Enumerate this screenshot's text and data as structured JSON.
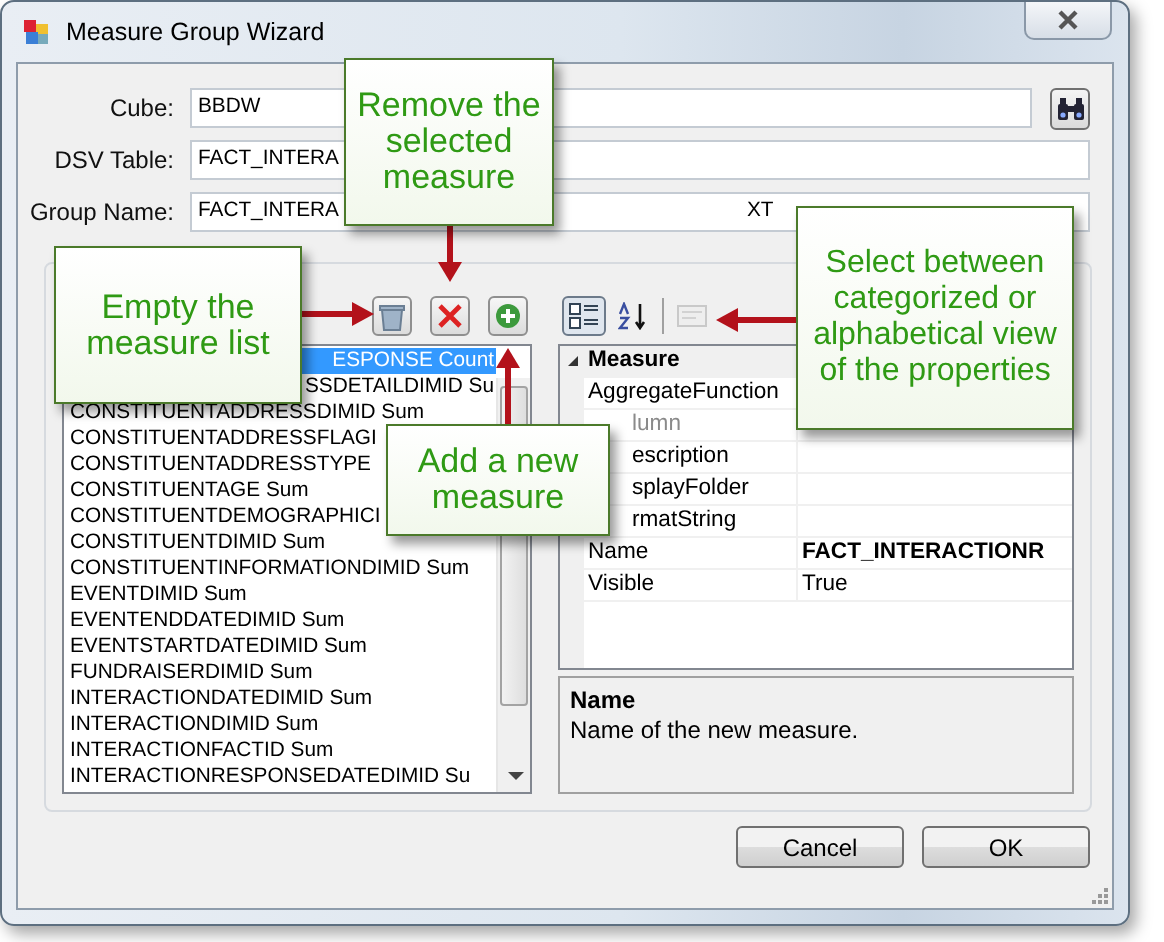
{
  "window": {
    "title": "Measure Group Wizard"
  },
  "fields": [
    {
      "label": "Cube:",
      "value": "BBDW",
      "kind": "browse"
    },
    {
      "label": "DSV Table:",
      "value": "FACT_INTERA",
      "kind": "text"
    },
    {
      "label": "Group Name:",
      "value": "FACT_INTERA",
      "value_tail": "XT",
      "kind": "text"
    }
  ],
  "measure_list": {
    "items": [
      {
        "text": "ESPONSE Count",
        "selected": true
      },
      {
        "text": "SSDETAILDIMID Su",
        "selected": false
      },
      {
        "text": "CONSTITUENTADDRESSDIMID Sum",
        "selected": false
      },
      {
        "text": "CONSTITUENTADDRESSFLAGI",
        "selected": false
      },
      {
        "text": "CONSTITUENTADDRESSTYPE",
        "selected": false
      },
      {
        "text": "CONSTITUENTAGE Sum",
        "selected": false
      },
      {
        "text": "CONSTITUENTDEMOGRAPHICI",
        "selected": false
      },
      {
        "text": "CONSTITUENTDIMID Sum",
        "selected": false
      },
      {
        "text": "CONSTITUENTINFORMATIONDIMID Sum",
        "selected": false
      },
      {
        "text": "EVENTDIMID Sum",
        "selected": false
      },
      {
        "text": "EVENTENDDATEDIMID Sum",
        "selected": false
      },
      {
        "text": "EVENTSTARTDATEDIMID Sum",
        "selected": false
      },
      {
        "text": "FUNDRAISERDIMID Sum",
        "selected": false
      },
      {
        "text": "INTERACTIONDATEDIMID Sum",
        "selected": false
      },
      {
        "text": "INTERACTIONDIMID Sum",
        "selected": false
      },
      {
        "text": "INTERACTIONFACTID Sum",
        "selected": false
      },
      {
        "text": "INTERACTIONRESPONSEDATEDIMID Su",
        "selected": false
      }
    ]
  },
  "property_grid": {
    "toolbar": [
      {
        "kind": "categorized",
        "selected": true,
        "disabled": false
      },
      {
        "kind": "alphabetical",
        "selected": false,
        "disabled": false
      },
      {
        "kind": "pages",
        "selected": false,
        "disabled": true
      }
    ],
    "category": {
      "name": "Measure",
      "expanded": true
    },
    "properties": [
      {
        "name": "AggregateFunction",
        "disabled": false
      },
      {
        "name": "lumn",
        "disabled": true
      },
      {
        "name": "escription",
        "disabled": false
      },
      {
        "name": "splayFolder",
        "disabled": false
      },
      {
        "name": "rmatString",
        "disabled": false
      },
      {
        "name": "Name",
        "value": "**FACT_INTERACTIONR**",
        "disabled": false
      },
      {
        "name": "Visible",
        "value": "True",
        "disabled": false
      }
    ],
    "description": {
      "title": "Name",
      "text": "Name of the new measure."
    }
  },
  "buttons": [
    "Cancel",
    "OK"
  ],
  "callouts": [
    {
      "text": "Remove the selected measure"
    },
    {
      "text": "Empty the measure list"
    },
    {
      "text": "Add a new measure"
    },
    {
      "text": "Select between categorized or alphabetical view of the properties"
    }
  ]
}
